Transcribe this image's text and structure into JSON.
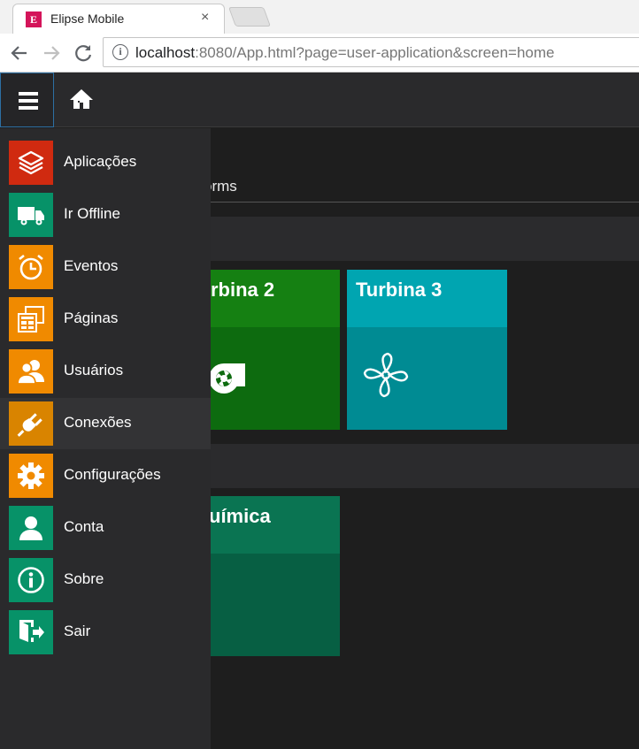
{
  "browser": {
    "tab_title": "Elipse Mobile",
    "tab_close": "×",
    "favicon_text": "E",
    "url_host": "localhost",
    "url_rest": ":8080/App.html?page=user-application&screen=home"
  },
  "content": {
    "tab_label": "orms",
    "tiles": [
      {
        "title": "rbina 2",
        "head_color": "#158012",
        "body_color": "#0d6b0f"
      },
      {
        "title": "Turbina 3",
        "head_color": "#00a5b1",
        "body_color": "#008b93"
      },
      {
        "title": "uímica",
        "head_color": "#0a7452",
        "body_color": "#075f43"
      }
    ]
  },
  "menu": {
    "items": [
      {
        "label": "Aplicações",
        "icon": "layers-icon",
        "color": "#d02a10"
      },
      {
        "label": "Ir Offline",
        "icon": "truck-icon",
        "color": "#079268"
      },
      {
        "label": "Eventos",
        "icon": "alarm-clock-icon",
        "color": "#f08a00"
      },
      {
        "label": "Páginas",
        "icon": "pages-icon",
        "color": "#f08a00"
      },
      {
        "label": "Usuários",
        "icon": "users-icon",
        "color": "#f08a00"
      },
      {
        "label": "Conexões",
        "icon": "plug-icon",
        "color": "#d98400"
      },
      {
        "label": "Configurações",
        "icon": "gear-icon",
        "color": "#f08a00"
      },
      {
        "label": "Conta",
        "icon": "user-icon",
        "color": "#079268"
      },
      {
        "label": "Sobre",
        "icon": "info-icon",
        "color": "#079268"
      },
      {
        "label": "Sair",
        "icon": "exit-icon",
        "color": "#079268"
      }
    ],
    "active_index": 5
  }
}
